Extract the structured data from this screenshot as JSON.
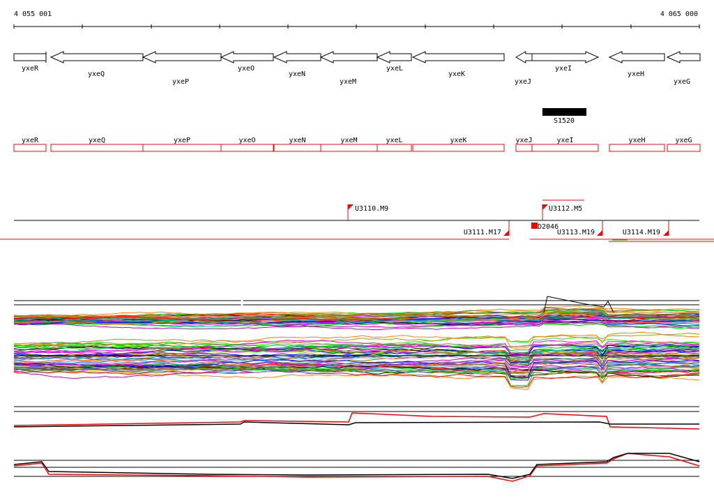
{
  "coords": {
    "start": "4 055 001",
    "end": "4 065 000"
  },
  "genes": [
    {
      "name": "yxeR",
      "dir": "right"
    },
    {
      "name": "yxeQ",
      "dir": "left"
    },
    {
      "name": "yxeP",
      "dir": "left"
    },
    {
      "name": "yxeO",
      "dir": "left"
    },
    {
      "name": "yxeN",
      "dir": "left"
    },
    {
      "name": "yxeM",
      "dir": "left"
    },
    {
      "name": "yxeL",
      "dir": "left"
    },
    {
      "name": "yxeK",
      "dir": "left"
    },
    {
      "name": "yxeJ",
      "dir": "left"
    },
    {
      "name": "yxeI",
      "dir": "right"
    },
    {
      "name": "yxeH",
      "dir": "left"
    },
    {
      "name": "yxeG",
      "dir": "left"
    }
  ],
  "feature_box": {
    "label": "S1520"
  },
  "transcripts": [
    {
      "label": "U3110.M9"
    },
    {
      "label": "U3112.M5"
    },
    {
      "label": "D2046"
    },
    {
      "label": "U3111.M17"
    },
    {
      "label": "U3113.M19"
    },
    {
      "label": "U3114.M19"
    }
  ],
  "colors": {
    "gene_box": "#ff0000",
    "marker": "#ff0000",
    "bar": "#000000"
  },
  "profile_palette": [
    "#ff00ff",
    "#00c000",
    "#0000ff",
    "#ff8000",
    "#00c0c0",
    "#c000c0",
    "#808000",
    "#ff0000",
    "#8080ff",
    "#00ff00",
    "#c08040",
    "#000000",
    "#ff80c0",
    "#4040a0",
    "#a0a000",
    "#008080"
  ]
}
